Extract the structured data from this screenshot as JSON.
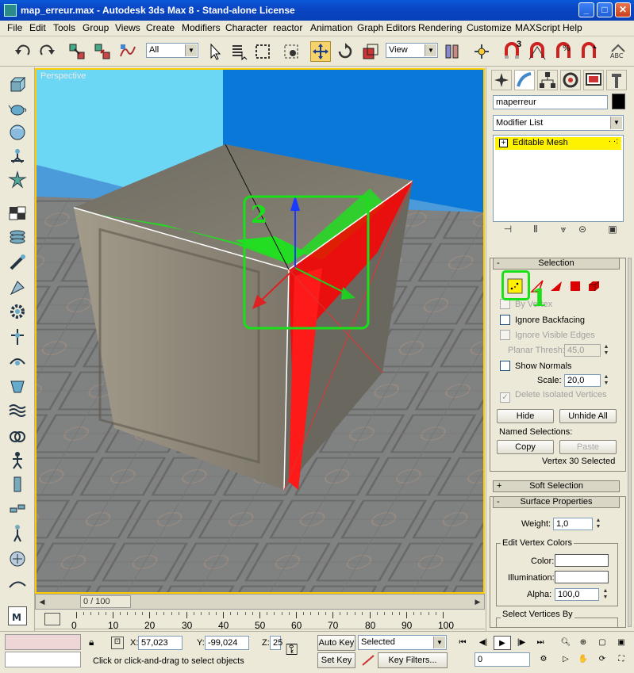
{
  "window": {
    "title": "map_erreur.max - Autodesk 3ds Max 8  - Stand-alone License",
    "minimize": "_",
    "maximize": "□",
    "close": "✕"
  },
  "menu": [
    "File",
    "Edit",
    "Tools",
    "Group",
    "Views",
    "Create",
    "Modifiers",
    "Character",
    "reactor",
    "Animation",
    "Graph Editors",
    "Rendering",
    "Customize",
    "MAXScript",
    "Help"
  ],
  "toolbar": {
    "selection_filter": "All",
    "reference_coord": "View",
    "icons": [
      "undo-icon",
      "redo-icon",
      "select-and-link-icon",
      "unlink-icon",
      "bind-space-warp-icon",
      "select-object-icon",
      "select-by-name-icon",
      "rectangular-selection-icon",
      "window-crossing-icon",
      "select-and-move-icon",
      "select-and-rotate-icon",
      "select-and-scale-icon",
      "pivot-point-icon",
      "select-and-manipulate-icon",
      "snaps-toggle-icon",
      "angle-snap-icon",
      "percent-snap-icon",
      "spinner-snap-icon",
      "abc-icon"
    ],
    "snap_label": "3"
  },
  "left_tabs": [
    "box-icon",
    "teapot-icon",
    "sphere-icon",
    "light-icon",
    "star-icon",
    "checker-icon",
    "layers-icon",
    "modifier-icon",
    "material-icon",
    "gear-icon",
    "pin-icon",
    "render-icon",
    "water-icon",
    "waves-icon",
    "link-icon",
    "character-icon",
    "bone-icon",
    "chain-icon",
    "biped-icon",
    "helper-icon",
    "camera-icon",
    "maxscript-icon"
  ],
  "viewport": {
    "label": "Perspective",
    "annotation_2": "2"
  },
  "time": {
    "frame_display": "0 / 100",
    "ticks": [
      "0",
      "10",
      "20",
      "30",
      "40",
      "50",
      "60",
      "70",
      "80",
      "90",
      "100"
    ]
  },
  "panel": {
    "object_name": "maperreur",
    "modifier_list": "Modifier List",
    "stack_item": "Editable Mesh",
    "selection_header": "Selection",
    "by_vertex": "By Vertex",
    "ignore_backfacing": "Ignore Backfacing",
    "ignore_visible_edges": "Ignore Visible Edges",
    "planar_thresh_label": "Planar Thresh:",
    "planar_thresh": "45,0",
    "show_normals": "Show Normals",
    "scale_label": "Scale:",
    "scale": "20,0",
    "delete_isolated": "Delete Isolated Vertices",
    "hide": "Hide",
    "unhide_all": "Unhide All",
    "named_selections": "Named Selections:",
    "copy": "Copy",
    "paste": "Paste",
    "selected_info": "Vertex 30 Selected",
    "soft_selection": "Soft Selection",
    "surface_properties": "Surface Properties",
    "weight_label": "Weight:",
    "weight": "1,0",
    "edit_vertex_colors": "Edit Vertex Colors",
    "color_label": "Color:",
    "illumination_label": "Illumination:",
    "alpha_label": "Alpha:",
    "alpha": "100,0",
    "select_vertices_by": "Select Vertices By",
    "annotation_1": "1",
    "accent": "#19e019"
  },
  "status": {
    "x_label": "X:",
    "x": "57,023",
    "y_label": "Y:",
    "y": "-99,024",
    "z_label": "Z:",
    "z": "25",
    "auto_key": "Auto Key",
    "set_key": "Set Key",
    "key_mode": "Selected",
    "key_filters": "Key Filters...",
    "current_frame": "0",
    "prompt": "Click or click-and-drag to select objects"
  }
}
